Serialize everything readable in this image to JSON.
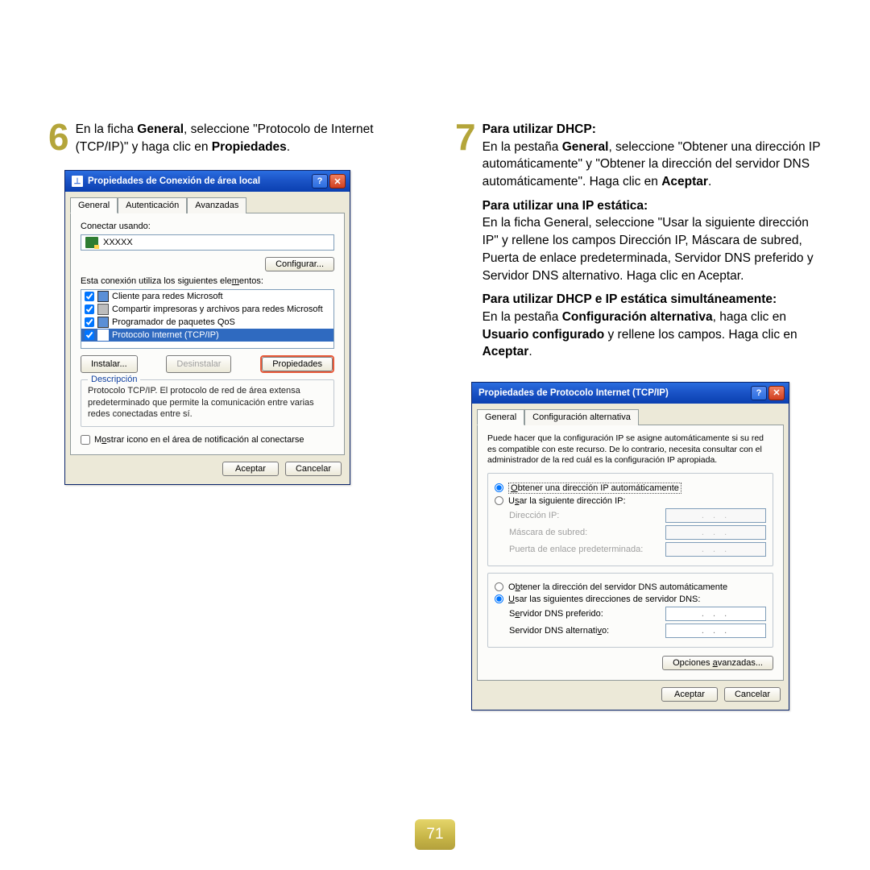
{
  "page_number": "71",
  "step6": {
    "num": "6",
    "text_pre": "En la ficha ",
    "text_b1": "General",
    "text_mid": ", seleccione \"Protocolo de Internet (TCP/IP)\" y haga clic en ",
    "text_b2": "Propiedades",
    "text_end": "."
  },
  "step7": {
    "num": "7",
    "lines": {
      "dhcp_head": "Para utilizar DHCP:",
      "dhcp_body_1": "En la pestaña ",
      "dhcp_body_b1": "General",
      "dhcp_body_2": ", seleccione \"Obtener una dirección IP automáticamente\" y \"Obtener la dirección del servidor DNS automáticamente\". Haga clic en ",
      "dhcp_body_b2": "Aceptar",
      "dhcp_body_3": ".",
      "static_head": "Para utilizar una IP estática:",
      "static_body": "En la ficha General, seleccione \"Usar la siguiente dirección IP\" y rellene los campos Dirección IP, Máscara de subred, Puerta de enlace predeterminada, Servidor DNS preferido y Servidor DNS alternativo. Haga clic en Aceptar.",
      "both_head": "Para utilizar DHCP e IP estática simultáneamente:",
      "both_1": "En la pestaña ",
      "both_b1": "Configuración alternativa",
      "both_2": ", haga clic en ",
      "both_b2": "Usuario configurado",
      "both_3": " y rellene los campos. Haga clic en ",
      "both_b3": "Aceptar",
      "both_4": "."
    }
  },
  "dialog1": {
    "title": "Propiedades de Conexión de área local",
    "tabs": [
      "General",
      "Autenticación",
      "Avanzadas"
    ],
    "connect_using_label": "Conectar usando:",
    "adapter": "XXXXX",
    "configure": "Configurar...",
    "elements_label": "Esta conexión utiliza los siguientes elementos:",
    "items": [
      "Cliente para redes Microsoft",
      "Compartir impresoras y archivos para redes Microsoft",
      "Programador de paquetes QoS",
      "Protocolo Internet (TCP/IP)"
    ],
    "install": "Instalar...",
    "uninstall": "Desinstalar",
    "properties": "Propiedades",
    "desc_legend": "Descripción",
    "desc_text": "Protocolo TCP/IP. El protocolo de red de área extensa predeterminado que permite la comunicación entre varias redes conectadas entre sí.",
    "show_icon": "Mostrar icono en el área de notificación al conectarse",
    "ok": "Aceptar",
    "cancel": "Cancelar"
  },
  "dialog2": {
    "title": "Propiedades de Protocolo Internet (TCP/IP)",
    "tabs": [
      "General",
      "Configuración alternativa"
    ],
    "info": "Puede hacer que la configuración IP se asigne automáticamente si su red es compatible con este recurso. De lo contrario, necesita consultar con el administrador de la red cuál es la configuración IP apropiada.",
    "radio_auto_ip": "Obtener una dirección IP automáticamente",
    "radio_static_ip": "Usar la siguiente dirección IP:",
    "field_ip": "Dirección IP:",
    "field_mask": "Máscara de subred:",
    "field_gw": "Puerta de enlace predeterminada:",
    "radio_auto_dns": "Obtener la dirección del servidor DNS automáticamente",
    "radio_static_dns": "Usar las siguientes direcciones de servidor DNS:",
    "field_dns1": "Servidor DNS preferido:",
    "field_dns2": "Servidor DNS alternativo:",
    "ip_dots": ".    .    .",
    "advanced": "Opciones avanzadas...",
    "ok": "Aceptar",
    "cancel": "Cancelar"
  }
}
